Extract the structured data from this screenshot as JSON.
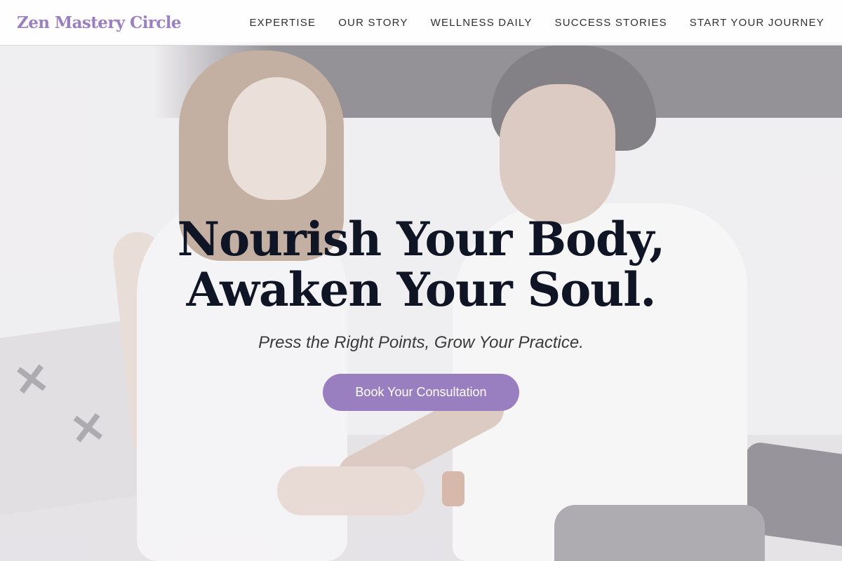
{
  "brand": {
    "logo_text": "Zen Mastery Circle",
    "accent_color": "#9a7fc0"
  },
  "nav": {
    "items": [
      {
        "label": "EXPERTISE"
      },
      {
        "label": "OUR STORY"
      },
      {
        "label": "WELLNESS DAILY"
      },
      {
        "label": "SUCCESS STORIES"
      },
      {
        "label": "START YOUR JOURNEY"
      }
    ]
  },
  "hero": {
    "headline_line1": "Nourish Your Body,",
    "headline_line2": "Awaken Your Soul.",
    "tagline": "Press the Right Points, Grow Your Practice.",
    "cta_label": "Book Your Consultation",
    "headline_color": "#0f1524"
  }
}
